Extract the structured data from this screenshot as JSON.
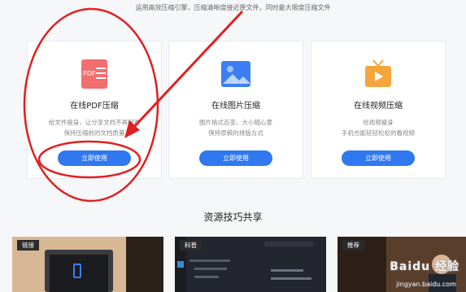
{
  "header": {
    "subtitle": "运用高效压缩引擎，压缩清晰度接近原文件，同时最大限度压缩文件"
  },
  "cards": [
    {
      "icon": "pdf-file-icon",
      "icon_label": "PDF",
      "title": "在线PDF压缩",
      "desc_line1": "给文件瘦身，让分享文档不再困难",
      "desc_line2": "保持压缩前的文档质量",
      "button": "立即使用",
      "color": "#f36e6e"
    },
    {
      "icon": "image-icon",
      "title": "在线图片压缩",
      "desc_line1": "图片格式百变，大小随心意",
      "desc_line2": "保持原稿的排版方式",
      "button": "立即使用",
      "color": "#3d7ef2"
    },
    {
      "icon": "video-tv-icon",
      "title": "在线视频压缩",
      "desc_line1": "给视频瘦身",
      "desc_line2": "手机也能轻轻松松的看视频",
      "button": "立即使用",
      "color": "#f5a53b"
    }
  ],
  "resources": {
    "title": "资源技巧共享",
    "items": [
      {
        "tag": "链接"
      },
      {
        "tag": "科普"
      },
      {
        "tag": "推荐"
      }
    ]
  },
  "watermark": {
    "text": "Baidu 经验",
    "url": "jingyan.baidu.com"
  },
  "colors": {
    "accent": "#2f78f0",
    "annotation": "#e02020",
    "background": "#f6f7f9"
  }
}
